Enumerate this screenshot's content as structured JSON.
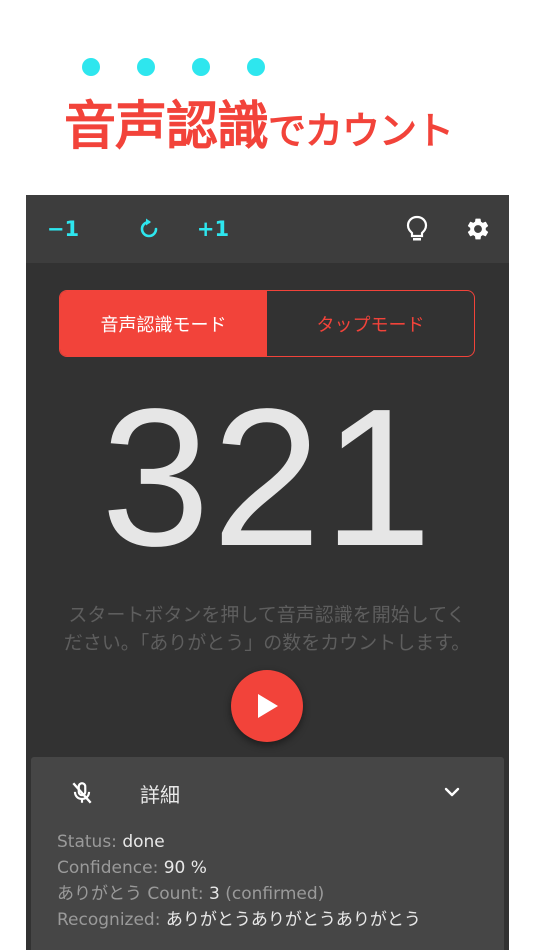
{
  "headline": {
    "emphasis": "音声認識",
    "rest": "でカウント",
    "dot_color": "#2ee6ee",
    "text_color": "#f2433a"
  },
  "toolbar": {
    "minus_label": "−1",
    "plus_label": "+1",
    "icons": [
      "reset-icon",
      "lightbulb-icon",
      "gear-icon"
    ]
  },
  "mode": {
    "voice_label": "音声認識モード",
    "tap_label": "タップモード",
    "selected": "voice"
  },
  "counter": {
    "value": "321"
  },
  "instructions": "スタートボタンを押して音声認識を開始してください。「ありがとう」の数をカウントします。",
  "details": {
    "title": "詳細",
    "status_label": "Status:",
    "status_value": "done",
    "confidence_label": "Confidence:",
    "confidence_value": "90 %",
    "count_label": "ありがとう Count:",
    "count_value": "3",
    "count_note": "(confirmed)",
    "recognized_label": "Recognized:",
    "recognized_value": "ありがとうありがとうありがとう"
  },
  "colors": {
    "accent": "#f2433a",
    "cyan": "#2ee6ee",
    "background": "#323232",
    "toolbar": "#3d3d3d",
    "panel": "#464646"
  }
}
